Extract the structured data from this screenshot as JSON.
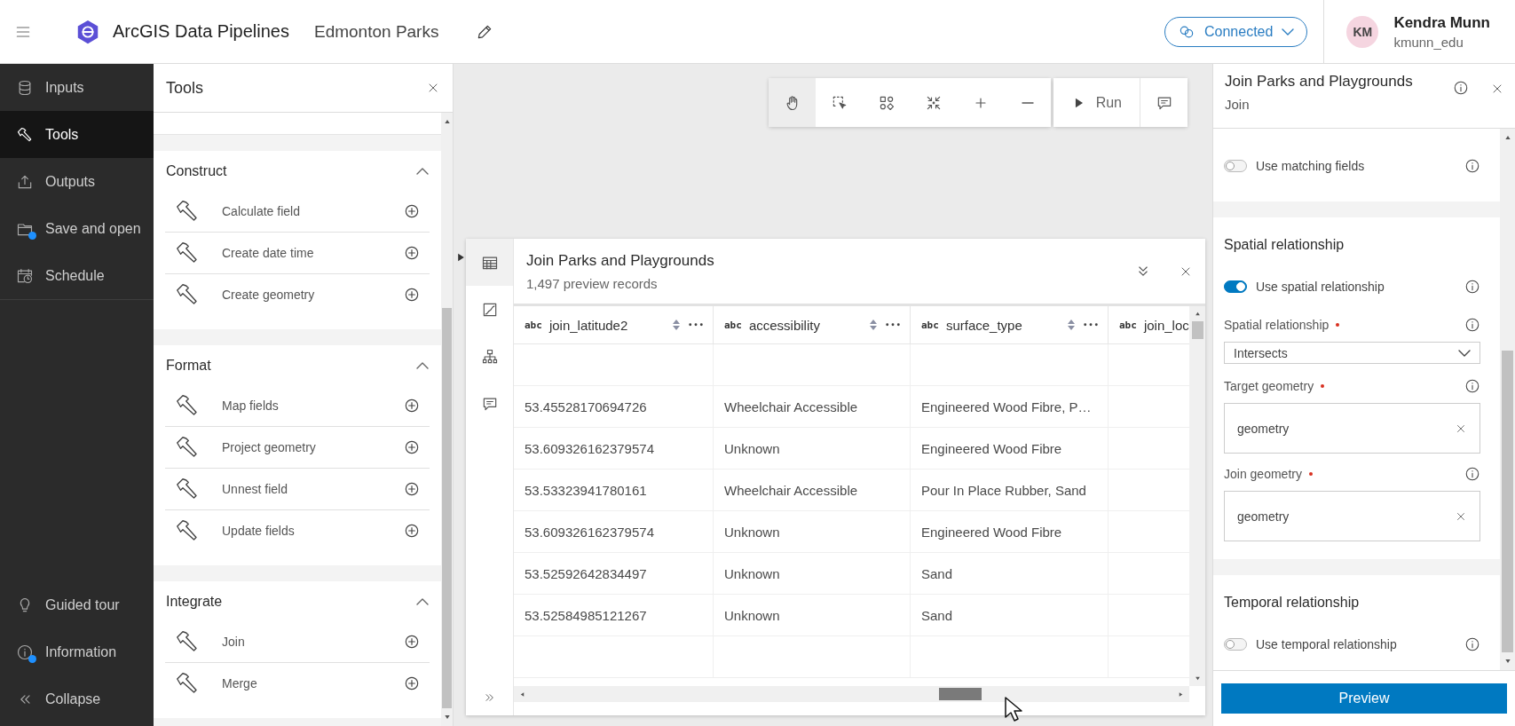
{
  "header": {
    "app_title": "ArcGIS Data Pipelines",
    "project_name": "Edmonton Parks",
    "connection": {
      "label": "Connected"
    },
    "user": {
      "initials": "KM",
      "name": "Kendra Munn",
      "username": "kmunn_edu"
    }
  },
  "nav": {
    "items": [
      {
        "label": "Inputs",
        "selected": false,
        "badge": false
      },
      {
        "label": "Tools",
        "selected": true,
        "badge": false
      },
      {
        "label": "Outputs",
        "selected": false,
        "badge": false
      },
      {
        "label": "Save and open",
        "selected": false,
        "badge": true
      },
      {
        "label": "Schedule",
        "selected": false,
        "badge": false
      }
    ],
    "footer_items": [
      {
        "label": "Guided tour",
        "badge": false
      },
      {
        "label": "Information",
        "badge": true
      },
      {
        "label": "Collapse",
        "badge": false
      }
    ]
  },
  "tools_panel": {
    "title": "Tools",
    "sections": [
      {
        "title": "Construct",
        "expanded": true,
        "tools": [
          "Calculate field",
          "Create date time",
          "Create geometry"
        ]
      },
      {
        "title": "Format",
        "expanded": true,
        "tools": [
          "Map fields",
          "Project geometry",
          "Unnest field",
          "Update fields"
        ]
      },
      {
        "title": "Integrate",
        "expanded": true,
        "tools": [
          "Join",
          "Merge"
        ]
      }
    ]
  },
  "canvas_toolbar": {
    "tools": [
      {
        "selected": true
      },
      {
        "selected": false
      },
      {
        "selected": false
      },
      {
        "selected": false
      },
      {
        "selected": false
      },
      {
        "selected": false
      }
    ],
    "run": {
      "label": "Run"
    }
  },
  "data_preview": {
    "title": "Join Parks and Playgrounds",
    "subtitle": "1,497 preview records",
    "side_tabs": [
      {
        "selected": true
      },
      {
        "selected": false
      },
      {
        "selected": false
      },
      {
        "selected": false
      }
    ],
    "columns": [
      {
        "type": "abc",
        "name": "join_latitude2"
      },
      {
        "type": "abc",
        "name": "accessibility"
      },
      {
        "type": "abc",
        "name": "surface_type"
      },
      {
        "type": "abc",
        "name": "join_loc"
      }
    ],
    "rows": [
      {
        "kind": "blank"
      },
      {
        "kind": "data",
        "cells": [
          "53.45528170694726",
          "Wheelchair Accessible",
          "Engineered Wood Fibre, P…"
        ]
      },
      {
        "kind": "data",
        "cells": [
          "53.609326162379574",
          "Unknown",
          "Engineered Wood Fibre"
        ]
      },
      {
        "kind": "data",
        "cells": [
          "53.53323941780161",
          "Wheelchair Accessible",
          "Pour In Place Rubber, Sand"
        ]
      },
      {
        "kind": "data",
        "cells": [
          "53.609326162379574",
          "Unknown",
          "Engineered Wood Fibre"
        ]
      },
      {
        "kind": "data",
        "cells": [
          "53.52592642834497",
          "Unknown",
          "Sand"
        ]
      },
      {
        "kind": "data",
        "cells": [
          "53.52584985121267",
          "Unknown",
          "Sand"
        ]
      },
      {
        "kind": "blank"
      }
    ]
  },
  "properties_panel": {
    "title": "Join Parks and Playgrounds",
    "subtitle": "Join",
    "sections": [
      {
        "items": [
          {
            "kind": "toggle",
            "label": "Use matching fields",
            "on": false
          }
        ]
      },
      {
        "title": "Spatial relationship",
        "items": [
          {
            "kind": "toggle",
            "label": "Use spatial relationship",
            "on": true
          },
          {
            "kind": "select",
            "label": "Spatial relationship",
            "required": true,
            "value": "Intersects"
          },
          {
            "kind": "field",
            "label": "Target geometry",
            "required": true,
            "value": "geometry"
          },
          {
            "kind": "field",
            "label": "Join geometry",
            "required": true,
            "value": "geometry"
          }
        ]
      },
      {
        "title": "Temporal relationship",
        "items": [
          {
            "kind": "toggle",
            "label": "Use temporal relationship",
            "on": false
          }
        ]
      }
    ],
    "primary_button": {
      "label": "Preview"
    }
  }
}
